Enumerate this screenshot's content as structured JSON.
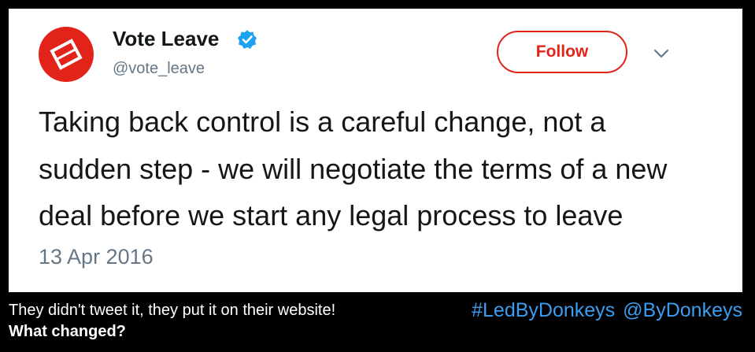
{
  "account": {
    "name": "Vote Leave",
    "handle": "@vote_leave",
    "follow_label": "Follow"
  },
  "tweet": {
    "lines": [
      "Taking back control is a careful change, not a",
      "sudden step - we will negotiate the terms of a new",
      "deal before we start any legal process to leave"
    ],
    "date": "13 Apr 2016"
  },
  "caption": {
    "line1": "They didn't tweet it, they put it on their website!",
    "line2": "What changed?"
  },
  "tags": {
    "hashtag": "#LedByDonkeys",
    "mention": "@ByDonkeys"
  },
  "colors": {
    "brand_red": "#e2231a",
    "verified_blue": "#1da1f2",
    "tag_blue": "#3b9df0"
  },
  "icons": {
    "avatar": "vote-leave-logo-icon",
    "verified": "verified-badge-icon",
    "menu": "chevron-down-icon"
  }
}
